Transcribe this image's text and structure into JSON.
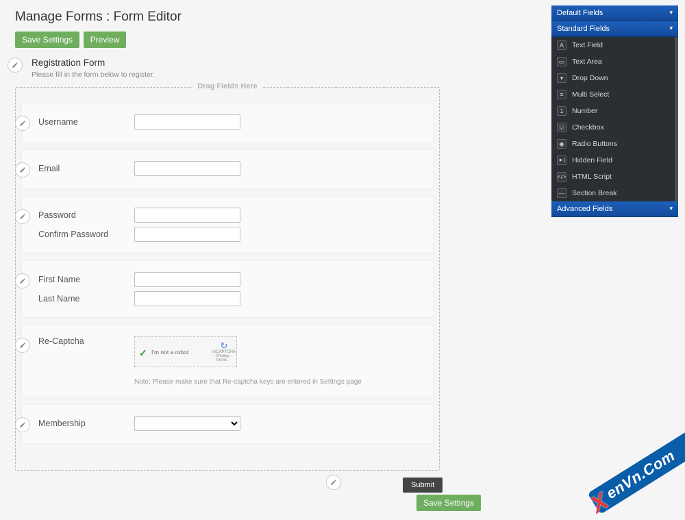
{
  "page_title": "Manage Forms : Form Editor",
  "buttons": {
    "save_settings": "Save Settings",
    "preview": "Preview",
    "submit": "Submit"
  },
  "form_header": {
    "title": "Registration Form",
    "subtitle": "Please fill in the form below to register."
  },
  "drag_label": "Drag Fields Here",
  "fields": {
    "username": "Username",
    "email": "Email",
    "password": "Password",
    "confirm_password": "Confirm Password",
    "first_name": "First Name",
    "last_name": "Last Name",
    "recaptcha": "Re-Captcha",
    "recaptcha_inner": "I'm not a robot",
    "recaptcha_brand": "reCAPTCHA",
    "recaptcha_terms": "Privacy - Terms",
    "recaptcha_note": "Note: Please make sure that Re-captcha keys are entered in Settings page",
    "membership": "Membership"
  },
  "sidebar": {
    "panels": {
      "default": "Default Fields",
      "standard": "Standard Fields",
      "advanced": "Advanced Fields"
    },
    "standard_items": [
      {
        "icon": "A",
        "label": "Text Field"
      },
      {
        "icon": "▭",
        "label": "Text Area"
      },
      {
        "icon": "▾",
        "label": "Drop Down"
      },
      {
        "icon": "≡",
        "label": "Multi Select"
      },
      {
        "icon": "1",
        "label": "Number"
      },
      {
        "icon": "☑",
        "label": "Checkbox"
      },
      {
        "icon": "◉",
        "label": "Radio Buttons"
      },
      {
        "icon": "⯈І",
        "label": "Hidden Field"
      },
      {
        "icon": "</>",
        "label": "HTML Script"
      },
      {
        "icon": "—",
        "label": "Section Break"
      }
    ]
  },
  "watermark": {
    "x": "X",
    "rest": "enVn.Com"
  }
}
